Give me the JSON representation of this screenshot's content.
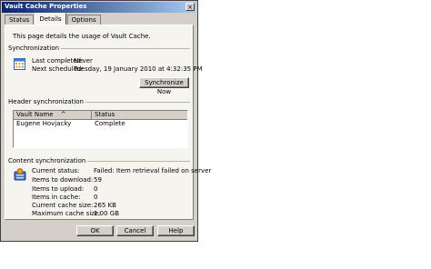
{
  "window": {
    "title": "Vault Cache Properties",
    "close_glyph": "×"
  },
  "tabs": [
    {
      "label": "Status"
    },
    {
      "label": "Details"
    },
    {
      "label": "Options"
    }
  ],
  "details": {
    "intro": "This page details the usage of Vault Cache.",
    "synchronization": {
      "heading": "Synchronization",
      "icon": "calendar-sync-icon",
      "last_completed_label": "Last completed:",
      "last_completed_value": "Never",
      "next_scheduled_label": "Next scheduled:",
      "next_scheduled_value": "Tuesday, 19 January 2010 at 4:32:35 PM",
      "sync_now_button": "Synchronize Now"
    },
    "header_sync": {
      "heading": "Header synchronization",
      "columns": [
        "Vault Name",
        "Status"
      ],
      "sort_glyph": "^",
      "rows": [
        {
          "vault": "Eugene Hovjacky",
          "status": "Complete"
        }
      ]
    },
    "content_sync": {
      "heading": "Content synchronization",
      "icon": "vault-content-icon",
      "rows": [
        {
          "label": "Current status:",
          "value": "Failed: Item retrieval failed on server"
        },
        {
          "label": "Items to download:",
          "value": "59"
        },
        {
          "label": "Items to upload:",
          "value": "0"
        },
        {
          "label": "Items in cache:",
          "value": "0"
        },
        {
          "label": "Current cache size:",
          "value": "265 KB"
        },
        {
          "label": "Maximum cache size:",
          "value": "1.00 GB"
        }
      ]
    }
  },
  "buttons": {
    "ok": "OK",
    "cancel": "Cancel",
    "help": "Help"
  },
  "colors": {
    "title_bar": "#0a246a",
    "dialog_face": "#d4d0c8",
    "panel_face": "#f5f4ef"
  }
}
